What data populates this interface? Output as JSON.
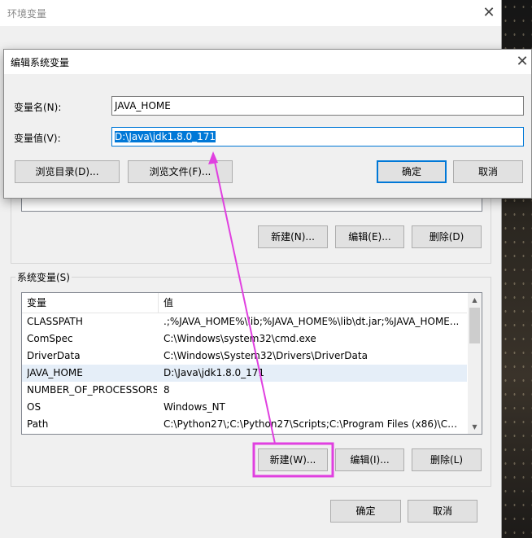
{
  "env_window": {
    "title": "环境变量",
    "system_vars_group_label": "系统变量(S)",
    "user_vars_buttons": {
      "new": "新建(N)...",
      "edit": "编辑(E)...",
      "delete": "删除(D)"
    },
    "system_vars_buttons": {
      "new": "新建(W)...",
      "edit": "编辑(I)...",
      "delete": "删除(L)"
    },
    "ok": "确定",
    "cancel": "取消",
    "columns": [
      "变量",
      "值"
    ],
    "rows": [
      {
        "name": "CLASSPATH",
        "value": ".;%JAVA_HOME%\\lib;%JAVA_HOME%\\lib\\dt.jar;%JAVA_HOME..."
      },
      {
        "name": "ComSpec",
        "value": "C:\\Windows\\system32\\cmd.exe"
      },
      {
        "name": "DriverData",
        "value": "C:\\Windows\\System32\\Drivers\\DriverData"
      },
      {
        "name": "JAVA_HOME",
        "value": "D:\\Java\\jdk1.8.0_171"
      },
      {
        "name": "NUMBER_OF_PROCESSORS",
        "value": "8"
      },
      {
        "name": "OS",
        "value": "Windows_NT"
      },
      {
        "name": "Path",
        "value": "C:\\Python27\\;C:\\Python27\\Scripts;C:\\Program Files (x86)\\Com..."
      }
    ],
    "selected_row": "JAVA_HOME"
  },
  "edit_dialog": {
    "title": "编辑系统变量",
    "name_label": "变量名(N):",
    "name_value": "JAVA_HOME",
    "value_label": "变量值(V):",
    "value_value": "D:\\Java\\jdk1.8.0_171",
    "browse_dir": "浏览目录(D)...",
    "browse_file": "浏览文件(F)...",
    "ok": "确定",
    "cancel": "取消"
  },
  "colors": {
    "annotation": "#e040e0",
    "accent": "#0078d7",
    "selection": "#e5eef8"
  },
  "icons": {
    "close": "close-icon",
    "scroll_up": "scroll-up-arrow-icon",
    "scroll_down": "scroll-down-arrow-icon"
  }
}
